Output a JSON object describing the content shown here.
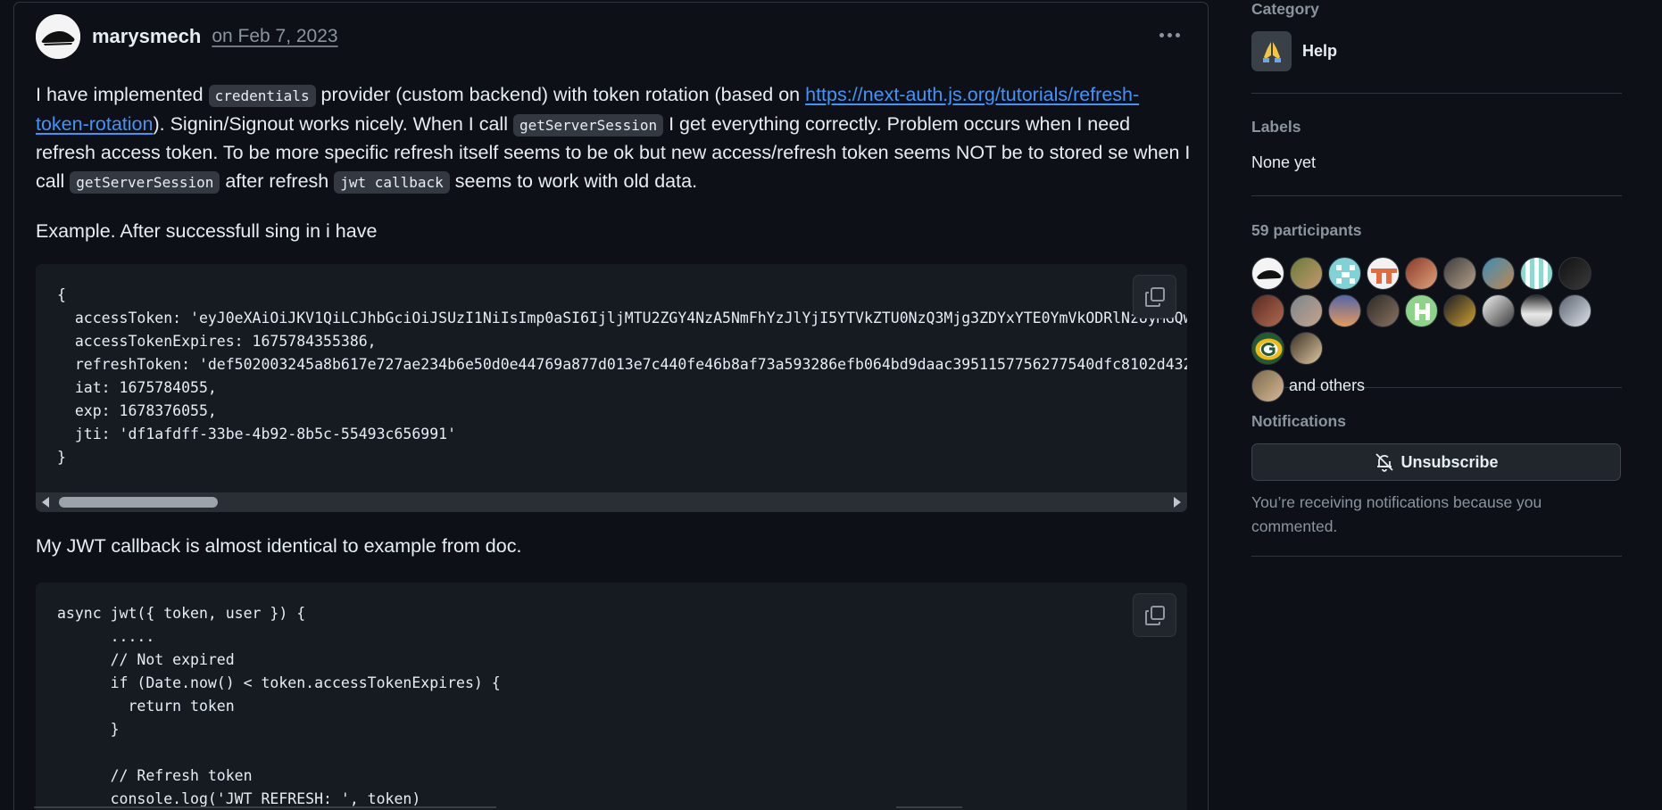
{
  "post": {
    "author": "marysmech",
    "date": "on Feb 7, 2023",
    "p1": {
      "t1": "I have implemented ",
      "c1": "credentials",
      "t2": " provider (custom backend) with token rotation (based on ",
      "link": "https://next-auth.js.org/tutorials/refresh-token-rotation",
      "t3": "). Signin/Signout works nicely. When I call ",
      "c2": "getServerSession",
      "t4": " I get everything correctly. Problem occurs when I need refresh access token. To be more specific refresh itself seems to be ok but new access/refresh token seems NOT be to stored se when I call ",
      "c3": "getServerSession",
      "t5": " after refresh ",
      "c4": "jwt callback",
      "t6": " seems to work with old data."
    },
    "p2": "Example. After successfull sing in i have",
    "code1": "{\n  accessToken: 'eyJ0eXAiOiJKV1QiLCJhbGciOiJSUzI1NiIsImp0aSI6IjljMTU2ZGY4NzA5NmFhYzJlYjI5YTVkZTU0NzQ3Mjg3ZDYxYTE0YmVkODRlNzUyMGQwO\n  accessTokenExpires: 1675784355386,\n  refreshToken: 'def502003245a8b617e727ae234b6e50d0e44769a877d013e7c440fe46b8af73a593286efb064bd9daac3951157756277540dfc8102d4324\n  iat: 1675784055,\n  exp: 1678376055,\n  jti: 'df1afdff-33be-4b92-8b5c-55493c656991'\n}",
    "p3": "My JWT callback is almost identical to example from doc.",
    "code2": "async jwt({ token, user }) {\n      .....\n      // Not expired\n      if (Date.now() < token.accessTokenExpires) {\n        return token\n      }\n\n      // Refresh token\n      console.log('JWT REFRESH: ', token)"
  },
  "sidebar": {
    "category_heading": "Category",
    "category_label": "Help",
    "category_icon": "folded-hands-icon",
    "labels_heading": "Labels",
    "labels_value": "None yet",
    "participants_heading": "59 participants",
    "and_others": "and others",
    "notifications_heading": "Notifications",
    "unsubscribe_label": "Unsubscribe",
    "notify_note": "You’re receiving notifications because you commented."
  },
  "colors": {
    "background": "#0d1117",
    "link": "#4493f8",
    "muted": "#8b949e",
    "border": "#30363d"
  }
}
